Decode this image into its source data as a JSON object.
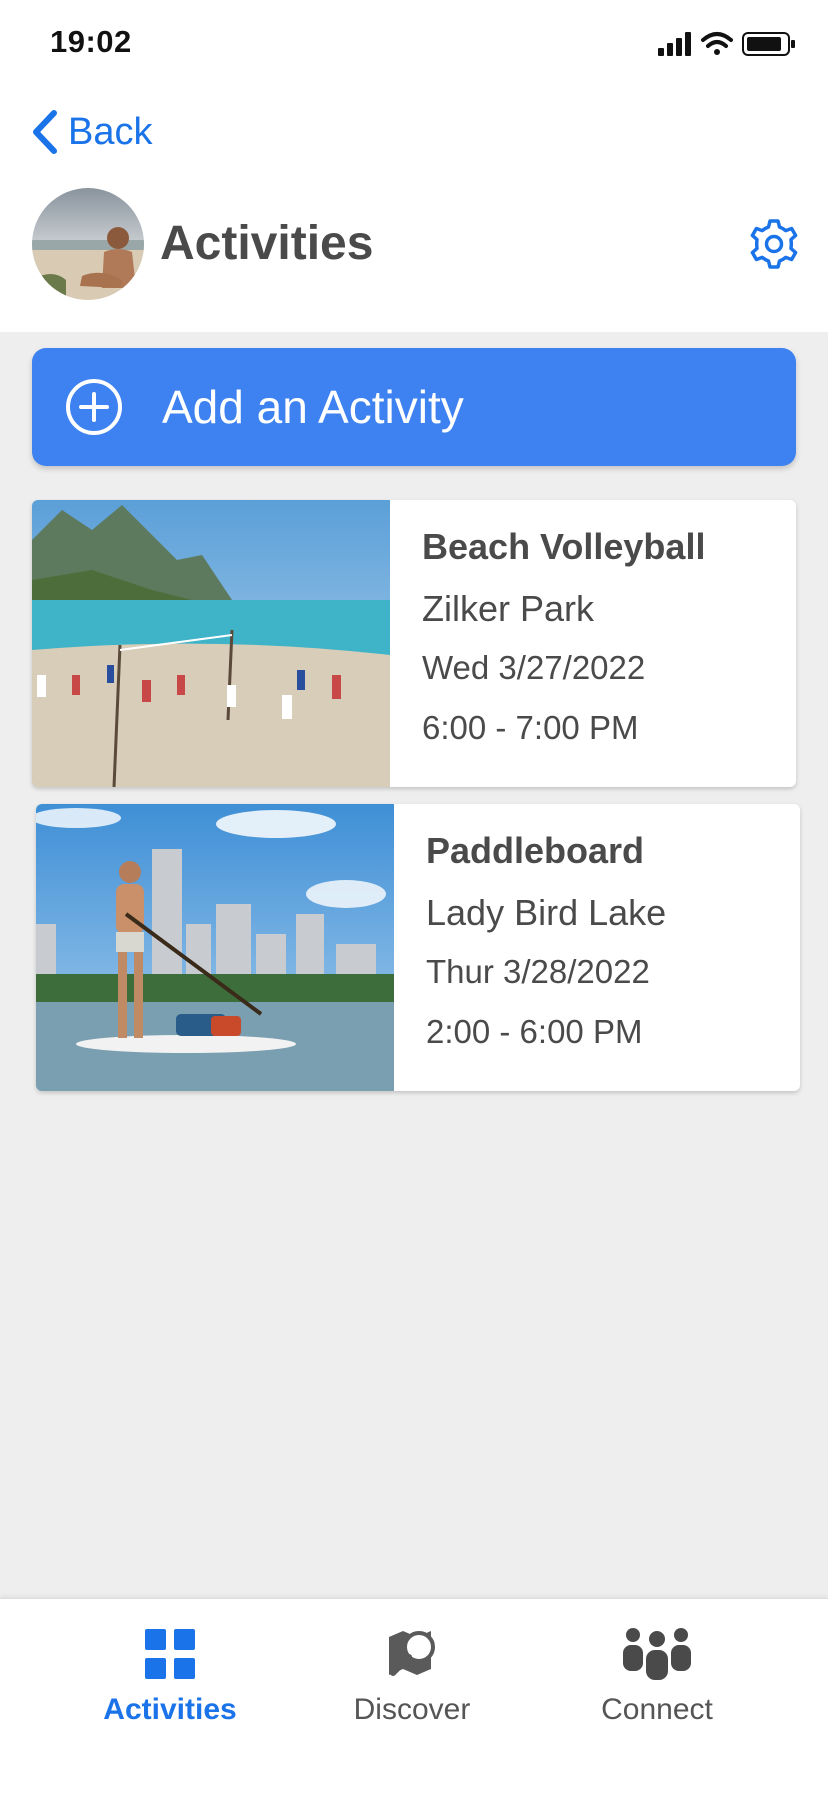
{
  "status_bar": {
    "time": "19:02"
  },
  "nav": {
    "back_label": "Back"
  },
  "header": {
    "title": "Activities"
  },
  "add_button": {
    "label": "Add an Activity"
  },
  "activities": [
    {
      "title": "Beach Volleyball",
      "location": "Zilker Park",
      "date": "Wed 3/27/2022",
      "time": "6:00 - 7:00 PM"
    },
    {
      "title": "Paddleboard",
      "location": "Lady Bird Lake",
      "date": "Thur 3/28/2022",
      "time": "2:00 - 6:00 PM"
    }
  ],
  "tabbar": {
    "tabs": [
      {
        "label": "Activities",
        "icon": "grid-icon",
        "active": true
      },
      {
        "label": "Discover",
        "icon": "map-search-icon",
        "active": false
      },
      {
        "label": "Connect",
        "icon": "people-icon",
        "active": false
      }
    ]
  },
  "colors": {
    "accent": "#1a73e8",
    "button": "#3d82f0",
    "background": "#eeeeee"
  }
}
